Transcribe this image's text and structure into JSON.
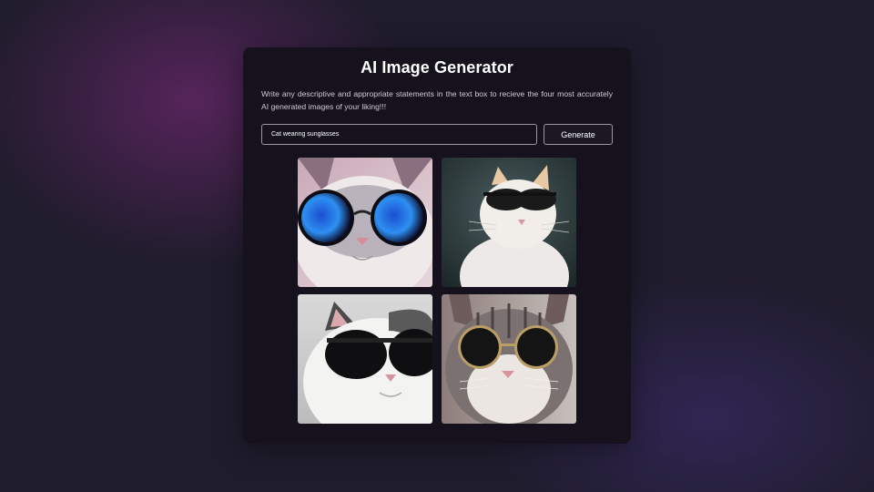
{
  "app": {
    "title": "AI Image Generator",
    "description": "Write any descriptive and appropriate statements in the text box to recieve the four most accurately AI generated images of your liking!!!"
  },
  "prompt": {
    "value": "Cat wearing sunglasses"
  },
  "generate_button": {
    "label": "Generate"
  },
  "gallery": [
    {
      "subject": "cat-with-blue-round-sunglasses"
    },
    {
      "subject": "white-cat-with-black-sunglasses"
    },
    {
      "subject": "white-cat-with-large-dark-sunglasses"
    },
    {
      "subject": "tabby-cat-with-round-sunglasses"
    }
  ],
  "colors": {
    "background": "#1f1c2c",
    "card": "#15121d",
    "text": "#ffffff",
    "border": "#9a97a3"
  }
}
